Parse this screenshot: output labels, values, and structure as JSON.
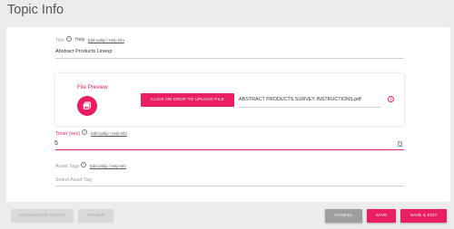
{
  "page": {
    "title": "Topic Info"
  },
  "title_field": {
    "label": "Title",
    "help_text": "Help",
    "help_link": "Edit tooltip / Help Info",
    "value": "Abstract Products Lineup"
  },
  "file_preview": {
    "label": "File Preview",
    "icon": "image-file-icon",
    "upload_button": "CLICK OR DROP TO UPLOAD FILE",
    "filename": "ABSTRACT PRODUCTS SURVEY INSTRUCTIONS.pdf",
    "status_icon": "error-info-icon"
  },
  "timer_field": {
    "label": "Timer (sec)",
    "help_link": "Edit tooltip / Help Info",
    "value": "5"
  },
  "asset_tags_field": {
    "label": "Asset Tags",
    "help_link": "Edit tooltip / Help Info",
    "placeholder": "Select Asset Tag"
  },
  "footer": {
    "knowledge_check": "KNOWLEDGE CHECK",
    "teaser": "TEASER",
    "cancel": "CANCEL",
    "save": "SAVE",
    "save_exit": "SAVE & EXIT"
  },
  "colors": {
    "accent": "#e91e63",
    "background": "#ececec",
    "disabled": "#d9d9d9"
  }
}
